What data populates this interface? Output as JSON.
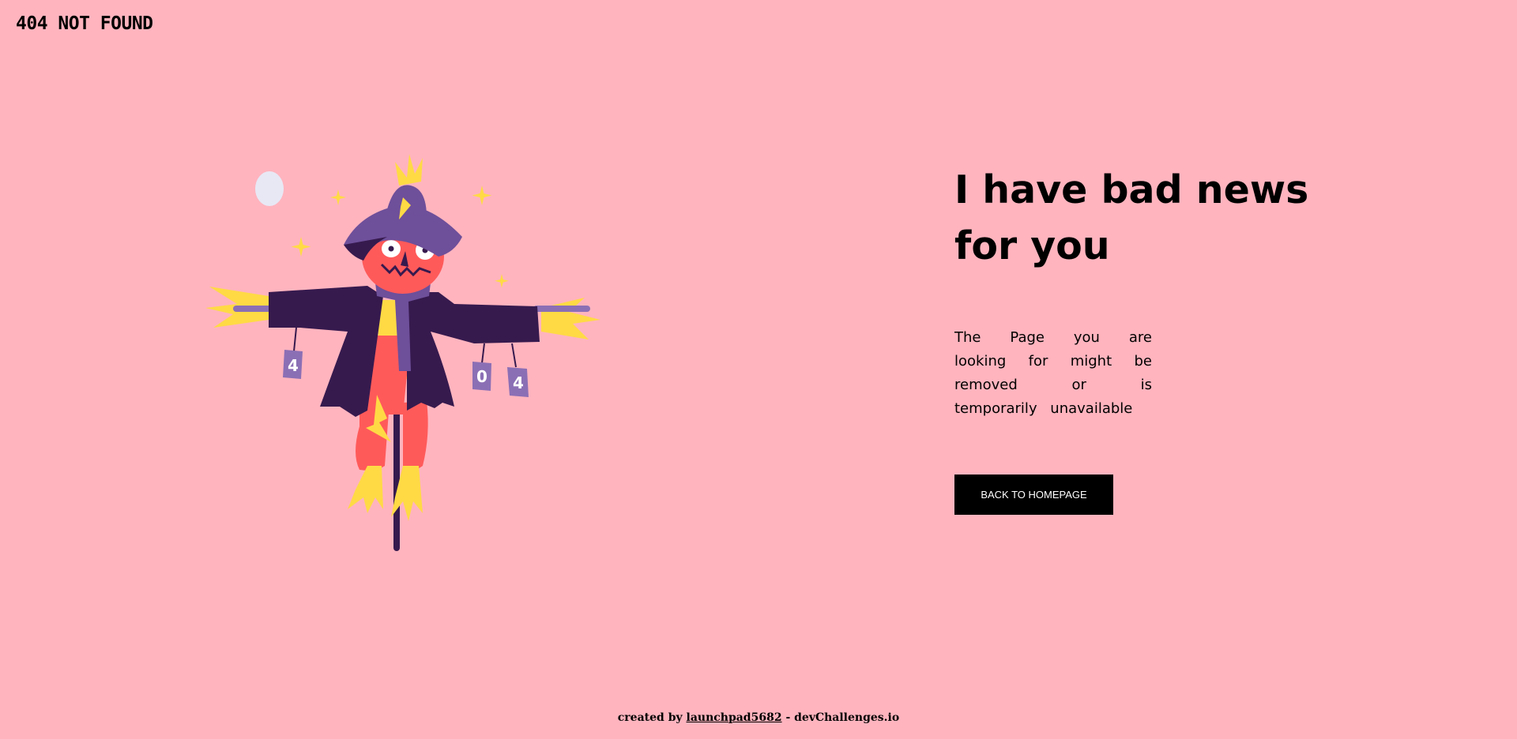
{
  "header": {
    "logo": "404 NOT FOUND"
  },
  "main": {
    "headline_line1": "I have bad news",
    "headline_line2": "for you",
    "message": "The Page you are looking for might be removed or is temporarily unavailable",
    "back_button_label": "BACK TO HOMEPAGE"
  },
  "illustration": {
    "description_icon": "scarecrow-illustration",
    "can_labels": [
      "4",
      "0",
      "4"
    ]
  },
  "footer": {
    "prefix": "created by",
    "author": "launchpad5682",
    "separator": " - ",
    "site": "devChallenges.io"
  },
  "colors": {
    "background": "#FFB4BE",
    "button": "#000000",
    "button_text": "#FFFFFF",
    "jacket": "#361A4E",
    "hat": "#6E4F9A",
    "face": "#FF5A5A",
    "straw": "#FFDA45",
    "moon": "#E8E8F5"
  }
}
